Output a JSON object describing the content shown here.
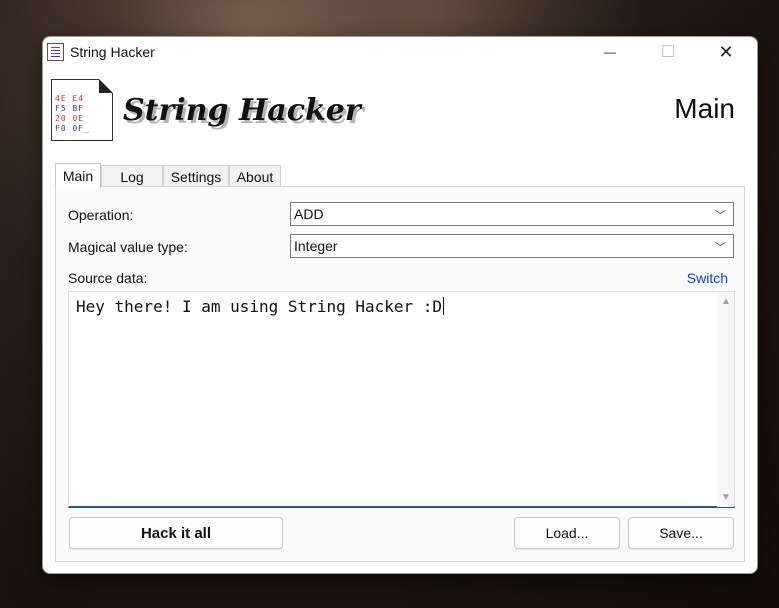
{
  "window": {
    "title": "String Hacker",
    "controls": {
      "minimize": "—",
      "maximize": "☐",
      "close": "✕"
    }
  },
  "header": {
    "logo_text": "String Hacker",
    "logo_hex_lines": [
      "4E E4",
      "F5 BF",
      "20 0E",
      "F0 0F_"
    ],
    "page_title": "Main"
  },
  "tabs": [
    {
      "label": "Main",
      "active": true
    },
    {
      "label": "Log",
      "active": false
    },
    {
      "label": "Settings",
      "active": false
    },
    {
      "label": "About",
      "active": false
    }
  ],
  "form": {
    "operation_label": "Operation:",
    "operation_value": "ADD",
    "value_type_label": "Magical value type:",
    "value_type_value": "Integer",
    "source_label": "Source data:",
    "switch_label": "Switch",
    "source_text": "Hey there! I am using String Hacker :D"
  },
  "buttons": {
    "hack": "Hack it all",
    "load": "Load...",
    "save": "Save..."
  },
  "colors": {
    "accent_blue": "#1e5a9e",
    "link": "#0645d6"
  }
}
